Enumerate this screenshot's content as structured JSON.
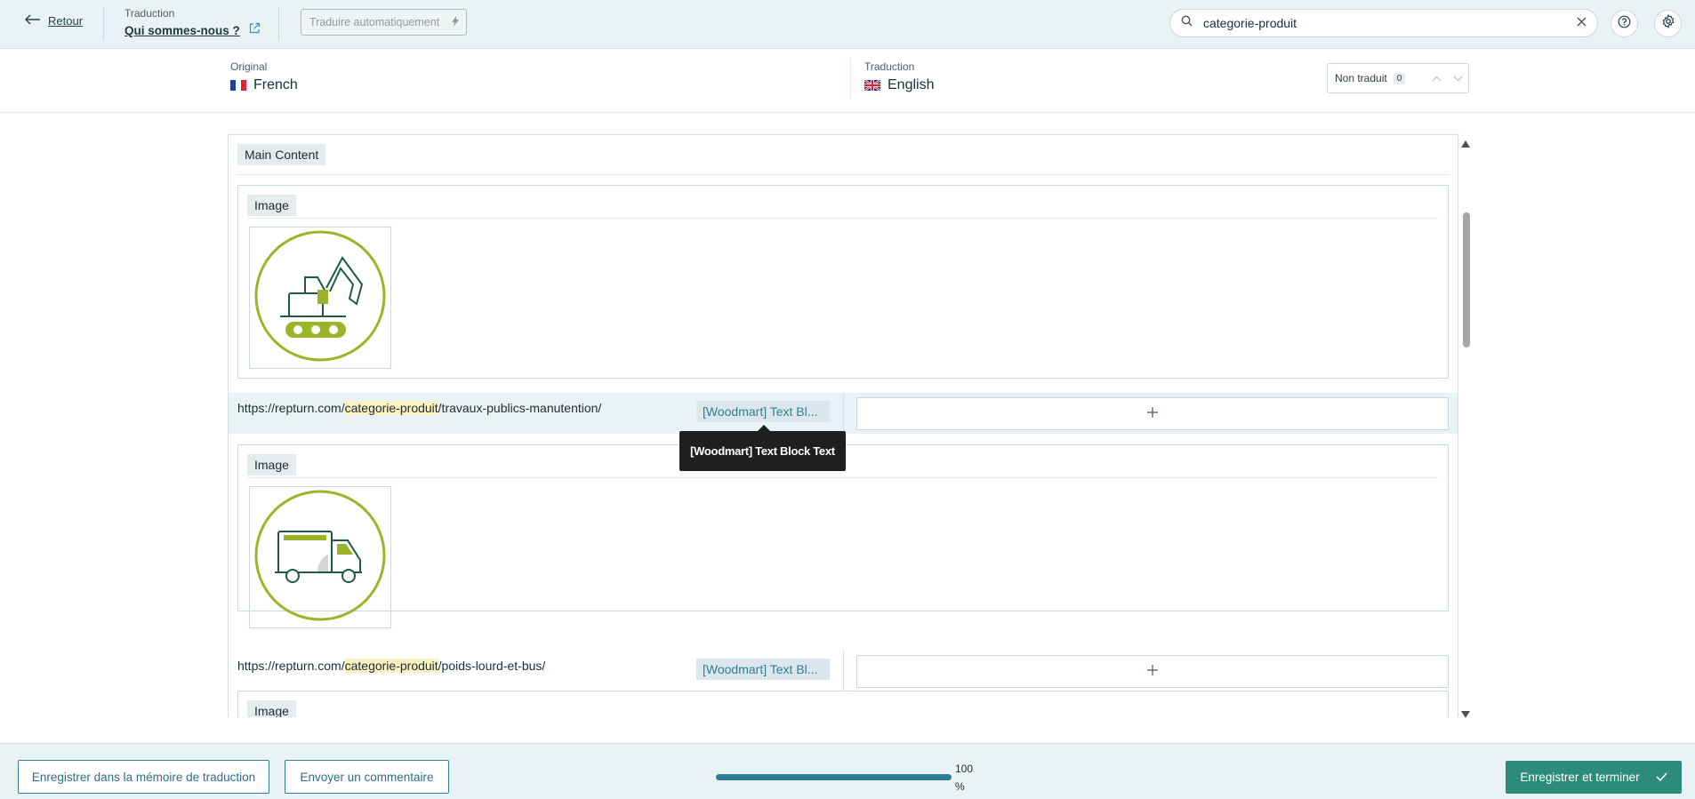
{
  "topbar": {
    "back_label": "Retour",
    "translation_caption": "Traduction",
    "page_title": "Qui sommes-nous ?",
    "auto_translate_label": "Traduire automatiquement",
    "search_value": "categorie-produit"
  },
  "languages": {
    "original_caption": "Original",
    "original_name": "French",
    "translation_caption": "Traduction",
    "translation_name": "English",
    "filter_label": "Non traduit",
    "filter_count": "0"
  },
  "content": {
    "section_label": "Main Content",
    "blocks": [
      {
        "label": "Image",
        "icon": "excavator-icon"
      },
      {
        "label": "Image",
        "icon": "truck-icon"
      },
      {
        "label": "Image"
      }
    ],
    "rows": [
      {
        "url_prefix": "https://repturn.com/",
        "url_match": "categorie-produit",
        "url_suffix": "/travaux-publics-manutention/",
        "chip": "[Woodmart] Text Bl..."
      },
      {
        "url_prefix": "https://repturn.com/",
        "url_match": "categorie-produit",
        "url_suffix": "/poids-lourd-et-bus/",
        "chip": "[Woodmart] Text Bl..."
      }
    ],
    "tooltip": "[Woodmart] Text Block Text"
  },
  "bottombar": {
    "save_memory_label": "Enregistrer dans la mémoire de traduction",
    "comment_label": "Envoyer un commentaire",
    "progress_value": "100",
    "progress_unit": "%",
    "progress_fraction": 1.0,
    "finish_label": "Enregistrer et terminer"
  },
  "colors": {
    "accent": "#2f7e95",
    "primary_button": "#2d8b7c",
    "icon_green": "#9bb52a",
    "highlight": "#fbf0c2"
  }
}
